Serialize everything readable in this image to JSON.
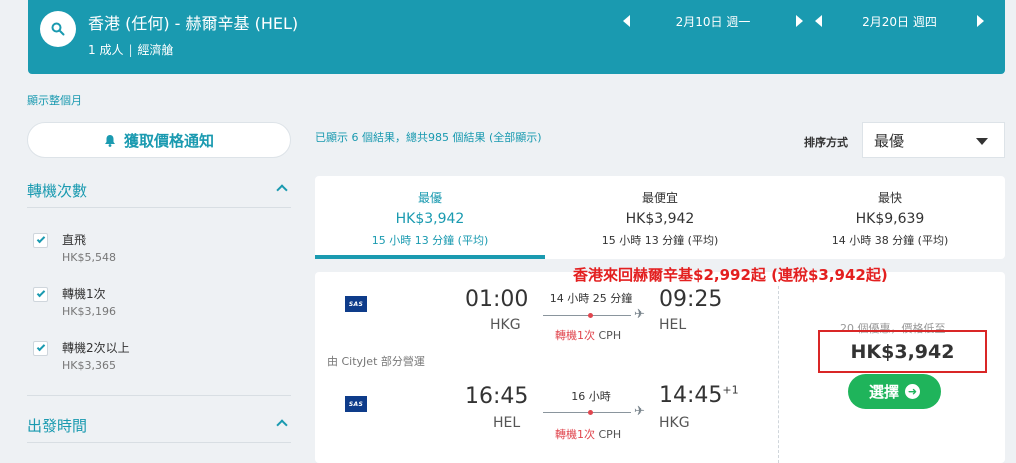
{
  "header": {
    "route": "香港 (任何) - 赫爾辛基 (HEL)",
    "pax": "1 成人",
    "cabin": "經濟艙",
    "depart_date": "2月10日 週一",
    "return_date": "2月20日 週四"
  },
  "show_month": "顯示整個月",
  "sidebar": {
    "alert_button": "獲取價格通知",
    "stops_title": "轉機次數",
    "stops": [
      {
        "label": "直飛",
        "price": "HK$5,548"
      },
      {
        "label": "轉機1次",
        "price": "HK$3,196"
      },
      {
        "label": "轉機2次以上",
        "price": "HK$3,365"
      }
    ],
    "depart_time_title": "出發時間"
  },
  "results": {
    "count_text": "已顯示 6 個結果，總共985 個結果 (全部顯示)",
    "sort_label": "排序方式",
    "sort_value": "最優"
  },
  "tabs": [
    {
      "name": "最優",
      "price": "HK$3,942",
      "duration": "15 小時 13 分鐘 (平均)"
    },
    {
      "name": "最便宜",
      "price": "HK$3,942",
      "duration": "15 小時 13 分鐘 (平均)"
    },
    {
      "name": "最快",
      "price": "HK$9,639",
      "duration": "14 小時 38 分鐘 (平均)"
    }
  ],
  "promo_text": "香港來回赫爾辛基$2,992起 (連稅$3,942起)",
  "result": {
    "airline_logo": "SAS",
    "outbound": {
      "depart_time": "01:00",
      "depart_airport": "HKG",
      "duration": "14 小時 25 分鐘",
      "stops": "轉機1次",
      "via": "CPH",
      "arrive_time": "09:25",
      "arrive_day_offset": "",
      "arrive_airport": "HEL"
    },
    "operated_by": "由 CityJet 部分營運",
    "inbound": {
      "depart_time": "16:45",
      "depart_airport": "HEL",
      "duration": "16 小時",
      "stops": "轉機1次",
      "via": "CPH",
      "arrive_time": "14:45",
      "arrive_day_offset": "+1",
      "arrive_airport": "HKG"
    },
    "deal_note": "20 個優惠，價格低至",
    "price": "HK$3,942",
    "select_button": "選擇"
  },
  "colors": {
    "brand": "#1a9ab0",
    "select_green": "#1fb45b",
    "promo_red": "#e32020",
    "stop_red": "#e0464e"
  }
}
